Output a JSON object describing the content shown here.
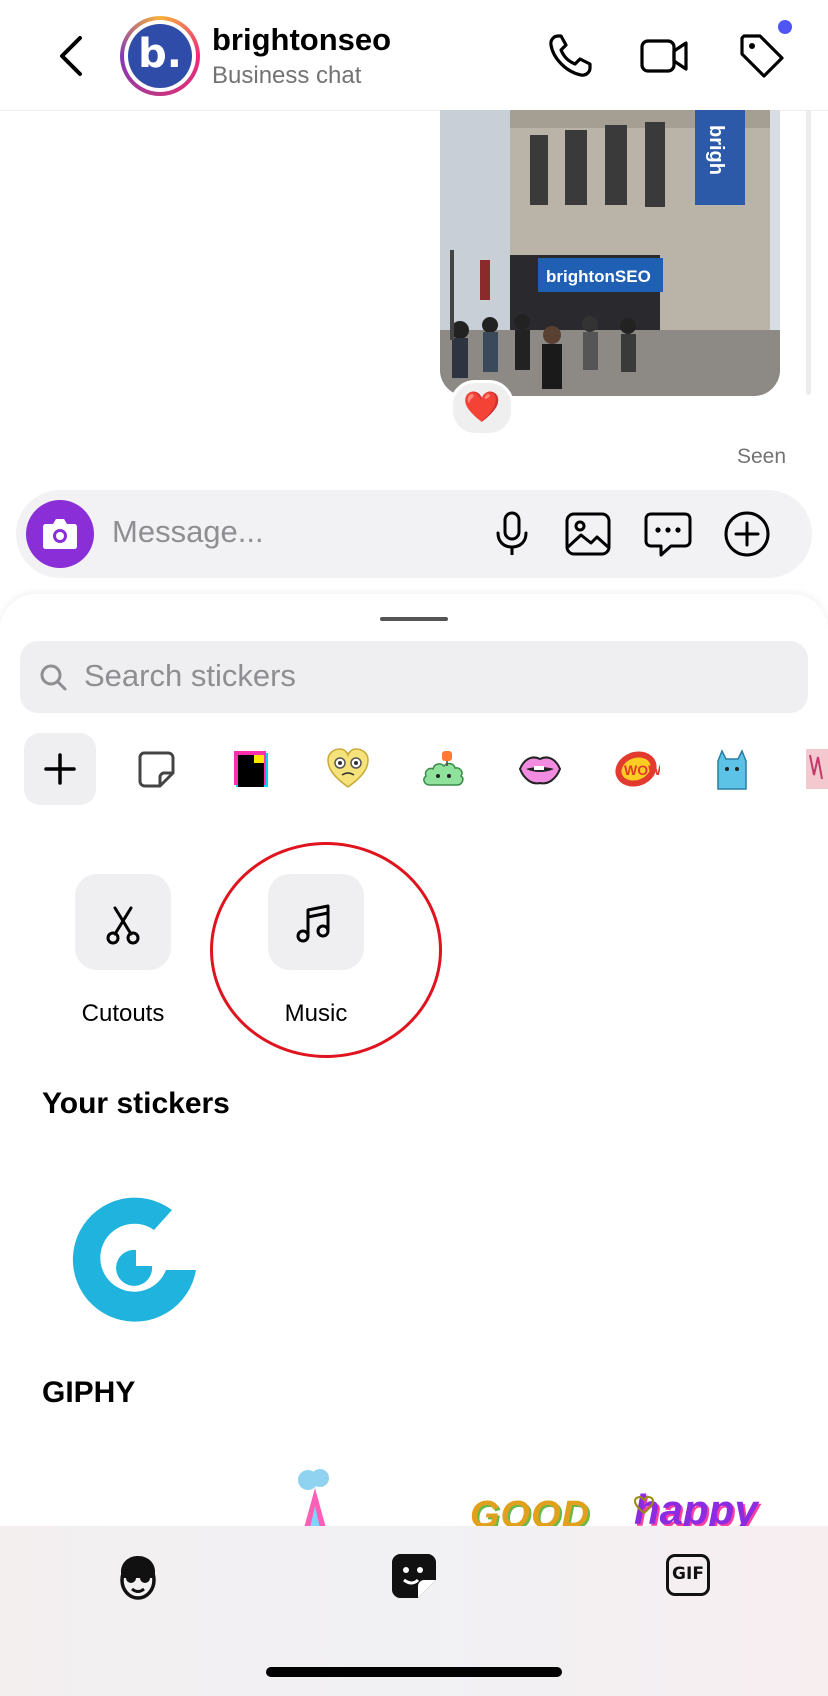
{
  "header": {
    "contact_name": "brightonseo",
    "contact_subtitle": "Business chat",
    "avatar_letter": "b.",
    "icons": [
      "back-chevron-icon",
      "phone-icon",
      "video-camera-icon",
      "tag-icon"
    ],
    "accent_dot_color": "#4f56f5"
  },
  "chat": {
    "photo_sign_text": "brightonSEO",
    "photo_banner_text": "brigh",
    "reaction": "❤️",
    "seen_label": "Seen"
  },
  "composer": {
    "placeholder": "Message...",
    "camera_button_color": "#8a2ed8",
    "icons": [
      "microphone-icon",
      "gallery-icon",
      "chat-bubble-icon",
      "add-circle-icon"
    ]
  },
  "sticker_panel": {
    "search_placeholder": "Search stickers",
    "tray_icons": [
      "add-icon",
      "sticker-outline-icon",
      "pixel-sticker",
      "heart-face-sticker",
      "cloud-sticker",
      "lips-sticker",
      "wow-sticker",
      "blue-creature-sticker",
      "partial-sticker"
    ],
    "tools": [
      {
        "label": "Cutouts",
        "icon": "scissors-icon"
      },
      {
        "label": "Music",
        "icon": "music-note-icon"
      }
    ],
    "your_stickers_heading": "Your stickers",
    "giphy_heading": "GIPHY",
    "giphy_previews": [
      "GOOD",
      "happy"
    ],
    "annotation_color": "#e0141e"
  },
  "bottom_tabs": [
    {
      "icon": "avatar-face-icon"
    },
    {
      "icon": "sticker-icon"
    },
    {
      "icon": "gif-icon",
      "label": "GIF"
    }
  ]
}
